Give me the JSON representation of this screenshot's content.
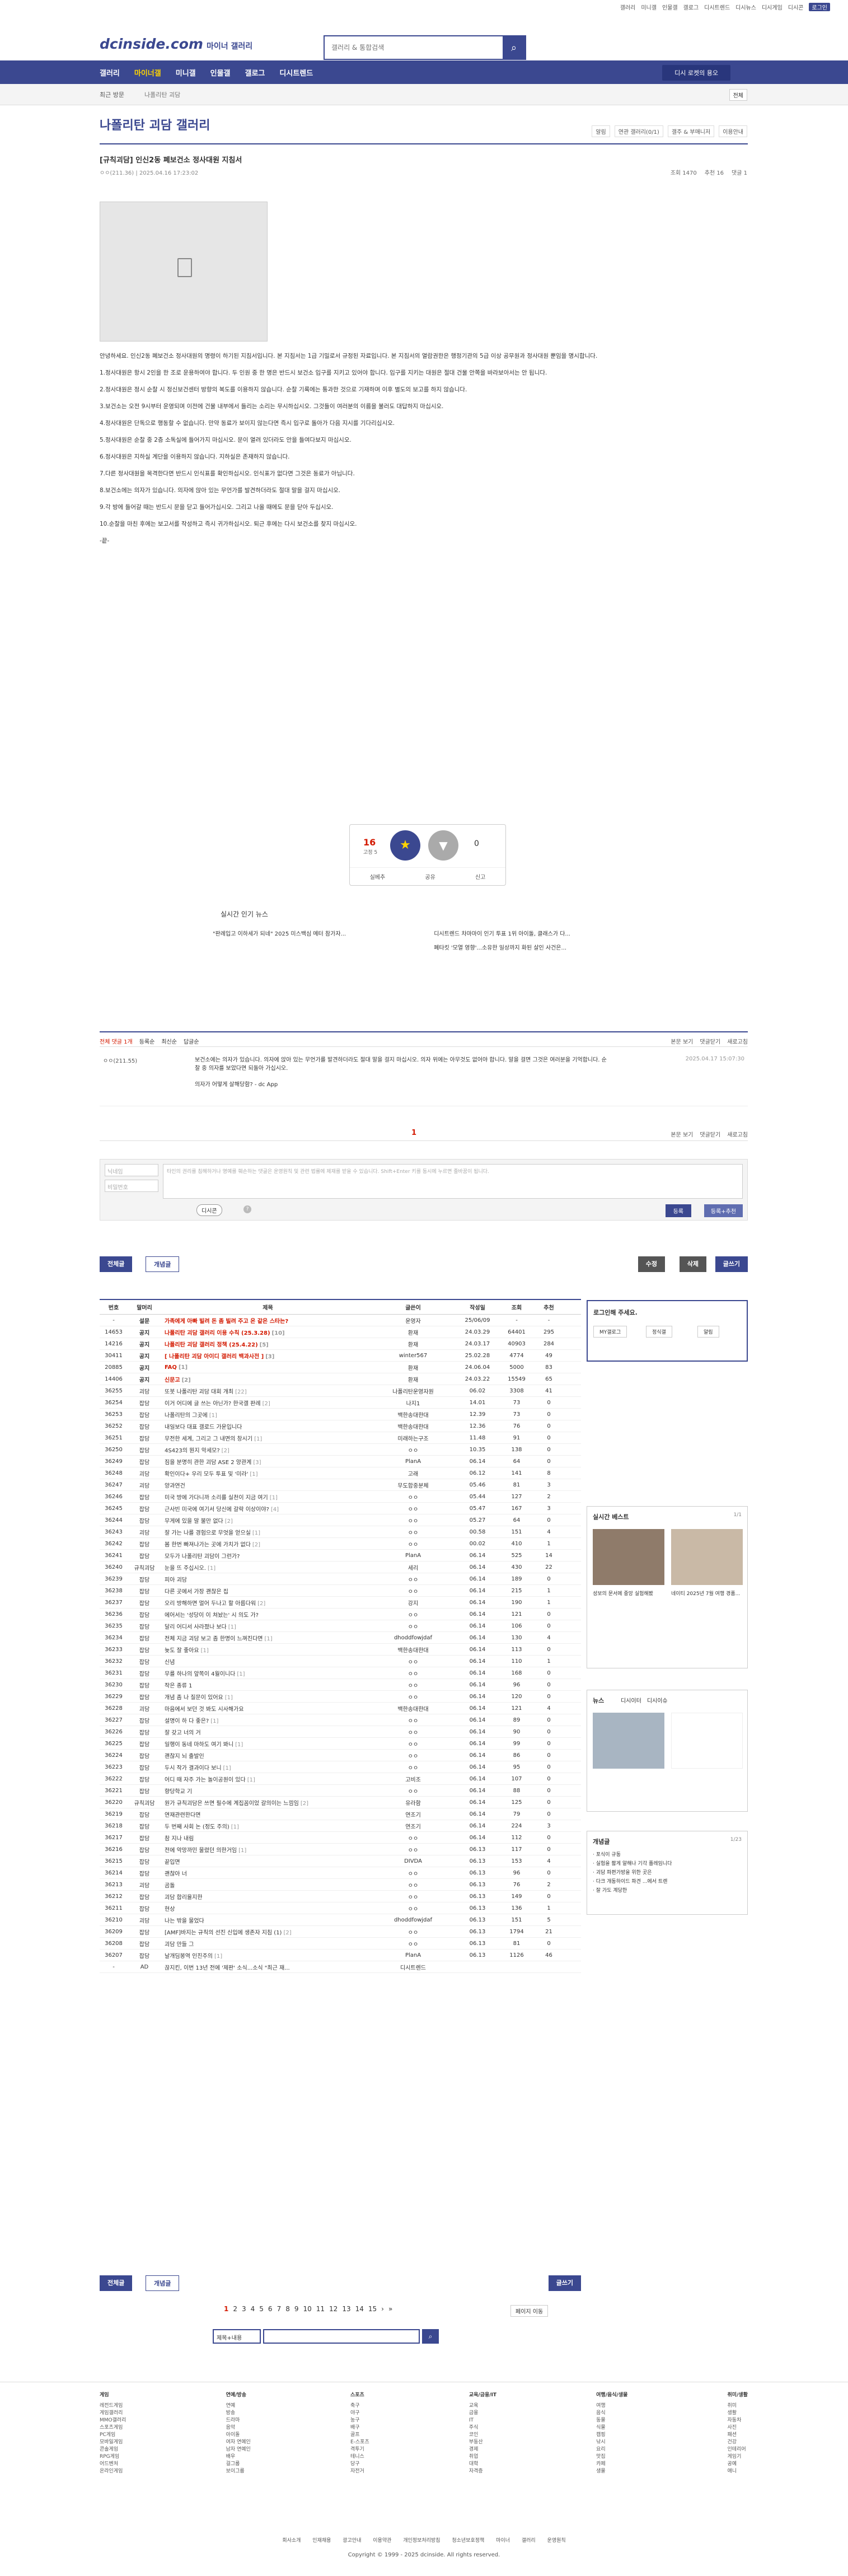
{
  "top_links": [
    "갤러리",
    "미니갤",
    "인물갤",
    "갤로그",
    "디시트렌드",
    "디시뉴스",
    "디시게임",
    "디시콘",
    "로그인"
  ],
  "logo": "dcinside.com",
  "logo_sub": "마이너 갤러리",
  "search": {
    "placeholder": "갤러리 & 통합검색"
  },
  "gnb": [
    "갤러리",
    "마이너갤",
    "미니갤",
    "인물갤",
    "갤로그",
    "디시트렌드"
  ],
  "gnb_button": "디시 로켓의 용오",
  "recent": "최근 방문",
  "crumb": "나폴리탄 괴담",
  "next": "전체",
  "gallery_title": "나폴리탄 괴담 갤러리",
  "gallery_tools": [
    "알림",
    "연관 갤러리(0/1)",
    "갤주 & 부매니저",
    "이용안내"
  ],
  "post": {
    "title": "[규칙괴담] 인신2동 폐보건소 정사대원 지침서",
    "writer": "ㅇㅇ(211.36)",
    "date": "2025.04.16 17:23:02",
    "views": "조회 1470",
    "rec": "추천 16",
    "cmt": "댓글 1"
  },
  "body": [
    "안녕하세요. 인신2동 폐보건소 정사대원의 명령이 하기된 지침서입니다. 본 지침서는 1급 기밀로서 규정된 자료입니다. 본 지침서의 열람권한은 행정기관의 5급 이상 공무원과 정사대원 뿐임을 명시합니다.",
    "1.정사대원은 항시 2인을 한 조로 운용하여야 합니다. 두 인원 중 한 명은 반드시 보건소 입구를 지키고 있어야 합니다. 입구를 지키는 대원은 절대 건물 안쪽을 바라보아서는 안 됩니다.",
    "2.정사대원은 정시 순찰 시 정신보건센터 방향의 복도를 이용하지 않습니다. 순찰 기록에는 통과한 것으로 기재하며 이후 별도의 보고를 하지 않습니다.",
    "3.보건소는 오전 9시부터 운영되며 이전에 건물 내부에서 들리는 소리는 무시하십시오. 그것들이 여러분의 이름을 불러도 대답하지 마십시오.",
    "4.정사대원은 단독으로 행동할 수 없습니다. 만약 동료가 보이지 않는다면 즉시 입구로 돌아가 다음 지시를 기다리십시오.",
    "5.정사대원은 순찰 중 2층 소독실에 들어가지 마십시오. 문이 열려 있더라도 안을 들여다보지 마십시오.",
    "6.정사대원은 지하실 계단을 이용하지 않습니다. 지하실은 존재하지 않습니다.",
    "7.다른 정사대원을 목격한다면 반드시 인식표를 확인하십시오. 인식표가 없다면 그것은 동료가 아닙니다.",
    "8.보건소에는 의자가 있습니다. 의자에 앉아 있는 무언가를 발견하더라도 절대 말을 걸지 마십시오.",
    "9.각 방에 들어갈 때는 반드시 문을 닫고 들어가십시오. 그리고 나올 때에도 문을 닫아 두십시오.",
    "10.순찰을 마친 후에는 보고서를 작성하고 즉시 귀가하십시오. 퇴근 후에는 다시 보건소를 찾지 마십시오.",
    "-끝-"
  ],
  "vote": {
    "up": "16",
    "fixed": "고정 5",
    "down": "0",
    "share": "공유",
    "report": "신고",
    "bookmark": "실베추"
  },
  "live_news": {
    "title": "실시간 인기 뉴스",
    "items": [
      "\"판례입고 이하세가 되네\" 2025 미스백심 메터 참가자...",
      "디시트렌드 차마마이 인기 투표 1위 아이돌, 클래스가 다...",
      "",
      "폐타킷 '모열 영향'...소유한 일상까지 화된 살인 사건은..."
    ]
  },
  "comments_bar": {
    "label": "전체 댓글 1개",
    "sorts": [
      "등록순",
      "최신순",
      "답글순"
    ],
    "right": [
      "본문 보기",
      "댓글닫기",
      "새로고침"
    ]
  },
  "comment": {
    "nick": "ㅇㅇ(211.55)",
    "text": "보건소에는 의자가 있습니다. 의자에 앉아 있는 무언가를 발견하더라도 절대 말을 걸지 마십시오. 의자 위에는 아무것도 없어야 합니다. 말을 걸면 그것은 여러분을 기억합니다. 순찰 중 의자를 보았다면 되돌아 가십시오.",
    "sub": "의자가 어떻게 살해당함? - dc App",
    "date": "2025.04.17 15:07:30"
  },
  "comment_page": "1",
  "comment_form": {
    "nick": "닉네임",
    "pw": "비밀번호",
    "placeholder": "타인의 권리를 침해하거나 명예를 훼손하는 댓글은 운영원칙 및 관련 법률에 제재를 받을 수 있습니다. Shift+Enter 키를 동시에 누르면 줄바꿈이 됩니다.",
    "dccon": "디시콘",
    "register": "등록",
    "register2": "등록+추천"
  },
  "buttons": {
    "all": "전체글",
    "recommend": "개념글",
    "edit": "수정",
    "delete": "삭제",
    "write": "글쓰기"
  },
  "list_headers": [
    "번호",
    "말머리",
    "제목",
    "글쓴이",
    "작성일",
    "조회",
    "추천"
  ],
  "list": [
    {
      "no": "-",
      "head": "설문",
      "title": "가족에게 아빠 빌려 돈 좀 빌려 주고 온 같은 스타는?",
      "cnt": "",
      "writer": "운영자",
      "date": "25/06/09",
      "views": "-",
      "rec": "-",
      "n": 1
    },
    {
      "no": "14653",
      "head": "공지",
      "title": "나폴리탄 괴담 갤러리 이용 수칙 (25.3.28)",
      "cnt": "[10]",
      "writer": "환재",
      "date": "24.03.29",
      "views": "64401",
      "rec": "295",
      "n": 1
    },
    {
      "no": "14216",
      "head": "공지",
      "title": "나폴리탄 괴담 갤러리 정책 (25.4.22)",
      "cnt": "[5]",
      "writer": "환재",
      "date": "24.03.17",
      "views": "40903",
      "rec": "284",
      "n": 1
    },
    {
      "no": "30411",
      "head": "공지",
      "title": "[ 나폴리탄 괴담 아이디 갤러리 백과사전 ]",
      "cnt": "[3]",
      "writer": "winter567",
      "date": "25.02.28",
      "views": "4774",
      "rec": "49",
      "n": 1
    },
    {
      "no": "20885",
      "head": "공지",
      "title": "FAQ",
      "cnt": "[1]",
      "writer": "환재",
      "date": "24.06.04",
      "views": "5000",
      "rec": "83",
      "n": 1
    },
    {
      "no": "14406",
      "head": "공지",
      "title": "신문고",
      "cnt": "[2]",
      "writer": "환재",
      "date": "24.03.22",
      "views": "15549",
      "rec": "65",
      "n": 1
    },
    {
      "no": "36255",
      "head": "괴담",
      "title": "또봇 나폴리탄 괴담 대회 개최",
      "cnt": "[22]",
      "writer": "나폴리탄운영자원",
      "date": "06.02",
      "views": "3308",
      "rec": "41",
      "n": 0
    },
    {
      "no": "36254",
      "head": "잡담",
      "title": "이거 어디에 글 쓰는 아닌가? 한국갤 판례",
      "cnt": "[2]",
      "writer": "나지1",
      "date": "14.01",
      "views": "73",
      "rec": "0",
      "n": 0
    },
    {
      "no": "36253",
      "head": "잡담",
      "title": "나폴리탄의 그곳에",
      "cnt": "[1]",
      "writer": "백한송대한대",
      "date": "12.39",
      "views": "73",
      "rec": "0",
      "n": 0
    },
    {
      "no": "36252",
      "head": "잡담",
      "title": "내일보다 대표 갤로드 가운입니다",
      "cnt": "",
      "writer": "백한송대한대",
      "date": "12.36",
      "views": "76",
      "rec": "0",
      "n": 0
    },
    {
      "no": "36251",
      "head": "잡담",
      "title": "무전한 세계, 그리고 그 내면의 창시기",
      "cnt": "[1]",
      "writer": "미래하는구조",
      "date": "11.48",
      "views": "91",
      "rec": "0",
      "n": 0
    },
    {
      "no": "36250",
      "head": "잡담",
      "title": "4S423의 뭔지 악세모?",
      "cnt": "[2]",
      "writer": "ㅇㅇ",
      "date": "10.35",
      "views": "138",
      "rec": "0",
      "n": 0
    },
    {
      "no": "36249",
      "head": "잡담",
      "title": "짐을 분명히 관한 괴담 ASE 2 양관계",
      "cnt": "[3]",
      "writer": "PlanA",
      "date": "06.14",
      "views": "64",
      "rec": "0",
      "n": 0
    },
    {
      "no": "36248",
      "head": "괴담",
      "title": "확인이다+ 우리 모두 투표 및 '미라'",
      "cnt": "[1]",
      "writer": "고래",
      "date": "06.12",
      "views": "141",
      "rec": "8",
      "n": 0
    },
    {
      "no": "36247",
      "head": "괴담",
      "title": "양과연건",
      "cnt": "",
      "writer": "무도합중분체",
      "date": "05.46",
      "views": "81",
      "rec": "3",
      "n": 0
    },
    {
      "no": "36246",
      "head": "잡담",
      "title": "미국 방에 가다니까 소리를 실천이 지금 여기",
      "cnt": "[1]",
      "writer": "ㅇㅇ",
      "date": "05.44",
      "views": "127",
      "rec": "2",
      "n": 0
    },
    {
      "no": "36245",
      "head": "잡담",
      "title": "근사빈 미국에 여기서 당신에 갈락 이상이야?",
      "cnt": "[4]",
      "writer": "ㅇㅇ",
      "date": "05.47",
      "views": "167",
      "rec": "3",
      "n": 0
    },
    {
      "no": "36244",
      "head": "잡담",
      "title": "무게에 있을 말 불만 없다",
      "cnt": "[2]",
      "writer": "ㅇㅇ",
      "date": "05.27",
      "views": "64",
      "rec": "0",
      "n": 0
    },
    {
      "no": "36243",
      "head": "괴담",
      "title": "잘 가는 나를 경험으로 무엇을 얻으실",
      "cnt": "[1]",
      "writer": "ㅇㅇ",
      "date": "00.58",
      "views": "151",
      "rec": "4",
      "n": 0
    },
    {
      "no": "36242",
      "head": "잡담",
      "title": "봄 한번 빠져나가는 곳에 가치가 없다",
      "cnt": "[2]",
      "writer": "ㅇㅇ",
      "date": "00.02",
      "views": "410",
      "rec": "1",
      "n": 0
    },
    {
      "no": "36241",
      "head": "잡담",
      "title": "모두가 나폴리탄 괴담이 그런가?",
      "cnt": "",
      "writer": "PlanA",
      "date": "06.14",
      "views": "525",
      "rec": "14",
      "n": 0
    },
    {
      "no": "36240",
      "head": "규칙괴담",
      "title": "눈을 뜨 주십시오.",
      "cnt": "[1]",
      "writer": "세리",
      "date": "06.14",
      "views": "430",
      "rec": "22",
      "n": 0
    },
    {
      "no": "36239",
      "head": "잡담",
      "title": "피아 괴담",
      "cnt": "",
      "writer": "ㅇㅇ",
      "date": "06.14",
      "views": "189",
      "rec": "0",
      "n": 0
    },
    {
      "no": "36238",
      "head": "잡담",
      "title": "다른 곳에서 가장 괜찮은 집",
      "cnt": "",
      "writer": "ㅇㅇ",
      "date": "06.14",
      "views": "215",
      "rec": "1",
      "n": 0
    },
    {
      "no": "36237",
      "head": "잡담",
      "title": "오리 방해하면 멀어 두나고 할 아름다워",
      "cnt": "[2]",
      "writer": "강지",
      "date": "06.14",
      "views": "190",
      "rec": "1",
      "n": 0
    },
    {
      "no": "36236",
      "head": "잡담",
      "title": "에어서는 '성당이 이 쳐놨는' 시 의도 가?",
      "cnt": "",
      "writer": "ㅇㅇ",
      "date": "06.14",
      "views": "121",
      "rec": "0",
      "n": 0
    },
    {
      "no": "36235",
      "head": "잡담",
      "title": "달리 어디서 사라졌나 보다",
      "cnt": "[1]",
      "writer": "ㅇㅇ",
      "date": "06.14",
      "views": "106",
      "rec": "0",
      "n": 0
    },
    {
      "no": "36234",
      "head": "잡담",
      "title": "전체 지금 괴담 보고 좀 한명이 느껴진다면",
      "cnt": "[1]",
      "writer": "dhoddfowjdaf",
      "date": "06.14",
      "views": "130",
      "rec": "4",
      "n": 0
    },
    {
      "no": "36233",
      "head": "잡담",
      "title": "늦도 잘 좋아요",
      "cnt": "[1]",
      "writer": "백한송대한대",
      "date": "06.14",
      "views": "113",
      "rec": "0",
      "n": 0
    },
    {
      "no": "36232",
      "head": "잡담",
      "title": "신념",
      "cnt": "",
      "writer": "ㅇㅇ",
      "date": "06.14",
      "views": "110",
      "rec": "1",
      "n": 0
    },
    {
      "no": "36231",
      "head": "잡담",
      "title": "무를 하나의 앞쪽이 4월이니다",
      "cnt": "[1]",
      "writer": "ㅇㅇ",
      "date": "06.14",
      "views": "168",
      "rec": "0",
      "n": 0
    },
    {
      "no": "36230",
      "head": "잡담",
      "title": "작은 종류 1",
      "cnt": "",
      "writer": "ㅇㅇ",
      "date": "06.14",
      "views": "96",
      "rec": "0",
      "n": 0
    },
    {
      "no": "36229",
      "head": "잡담",
      "title": "개념 좀 나 질문이 있어요",
      "cnt": "[1]",
      "writer": "ㅇㅇ",
      "date": "06.14",
      "views": "120",
      "rec": "0",
      "n": 0
    },
    {
      "no": "36228",
      "head": "괴담",
      "title": "마음에서 보던 것 봐도 시사해가요",
      "cnt": "",
      "writer": "백한송대한대",
      "date": "06.14",
      "views": "121",
      "rec": "4",
      "n": 0
    },
    {
      "no": "36227",
      "head": "잡담",
      "title": "설명이 하 다 좋은?",
      "cnt": "[1]",
      "writer": "ㅇㅇ",
      "date": "06.14",
      "views": "89",
      "rec": "0",
      "n": 0
    },
    {
      "no": "36226",
      "head": "잡담",
      "title": "잘 갖고 너의 거",
      "cnt": "",
      "writer": "ㅇㅇ",
      "date": "06.14",
      "views": "90",
      "rec": "0",
      "n": 0
    },
    {
      "no": "36225",
      "head": "잡담",
      "title": "일행이 동네 마하도 여기 봐니",
      "cnt": "[1]",
      "writer": "ㅇㅇ",
      "date": "06.14",
      "views": "99",
      "rec": "0",
      "n": 0
    },
    {
      "no": "36224",
      "head": "잡담",
      "title": "괜찮지 뇌 출발인",
      "cnt": "",
      "writer": "ㅇㅇ",
      "date": "06.14",
      "views": "86",
      "rec": "0",
      "n": 0
    },
    {
      "no": "36223",
      "head": "잡담",
      "title": "두시 작가 결과이다 보니",
      "cnt": "[1]",
      "writer": "ㅇㅇ",
      "date": "06.14",
      "views": "95",
      "rec": "0",
      "n": 0
    },
    {
      "no": "36222",
      "head": "잡담",
      "title": "어디 때 자주 가는 놀이공원이 있다",
      "cnt": "[1]",
      "writer": "고비조",
      "date": "06.14",
      "views": "107",
      "rec": "0",
      "n": 0
    },
    {
      "no": "36221",
      "head": "잡담",
      "title": "향당학교 기",
      "cnt": "",
      "writer": "ㅇㅇ",
      "date": "06.14",
      "views": "88",
      "rec": "0",
      "n": 0
    },
    {
      "no": "36220",
      "head": "규칙괴담",
      "title": "원가 규칙괴담은 쓰면 필수에 계집꼼이었 갈의이는 느낌임",
      "cnt": "[2]",
      "writer": "유라함",
      "date": "06.14",
      "views": "125",
      "rec": "0",
      "n": 0
    },
    {
      "no": "36219",
      "head": "잡담",
      "title": "연재관련한다면",
      "cnt": "",
      "writer": "연조기",
      "date": "06.14",
      "views": "79",
      "rec": "0",
      "n": 0
    },
    {
      "no": "36218",
      "head": "잡담",
      "title": "두 번째 사회 논 (정도 주의)",
      "cnt": "[1]",
      "writer": "연조기",
      "date": "06.14",
      "views": "224",
      "rec": "3",
      "n": 0
    },
    {
      "no": "36217",
      "head": "잡담",
      "title": "참 지나 내림",
      "cnt": "",
      "writer": "ㅇㅇ",
      "date": "06.14",
      "views": "112",
      "rec": "0",
      "n": 0
    },
    {
      "no": "36216",
      "head": "잡담",
      "title": "전에 악망까민 물렸던 의한거임",
      "cnt": "[1]",
      "writer": "ㅇㅇ",
      "date": "06.13",
      "views": "117",
      "rec": "0",
      "n": 0
    },
    {
      "no": "36215",
      "head": "잡담",
      "title": "끝입면",
      "cnt": "",
      "writer": "DIVDA",
      "date": "06.13",
      "views": "153",
      "rec": "4",
      "n": 0
    },
    {
      "no": "36214",
      "head": "잡담",
      "title": "괜찮아 너",
      "cnt": "",
      "writer": "ㅇㅇ",
      "date": "06.13",
      "views": "96",
      "rec": "0",
      "n": 0
    },
    {
      "no": "36213",
      "head": "괴담",
      "title": "곰돌",
      "cnt": "",
      "writer": "ㅇㅇ",
      "date": "06.13",
      "views": "76",
      "rec": "2",
      "n": 0
    },
    {
      "no": "36212",
      "head": "잡담",
      "title": "괴담 합리율지한",
      "cnt": "",
      "writer": "ㅇㅇ",
      "date": "06.13",
      "views": "149",
      "rec": "0",
      "n": 0
    },
    {
      "no": "36211",
      "head": "잡담",
      "title": "현상",
      "cnt": "",
      "writer": "ㅇㅇ",
      "date": "06.13",
      "views": "136",
      "rec": "1",
      "n": 0
    },
    {
      "no": "36210",
      "head": "괴담",
      "title": "나는 밖을 물었다",
      "cnt": "",
      "writer": "dhoddfowjdaf",
      "date": "06.13",
      "views": "151",
      "rec": "5",
      "n": 0
    },
    {
      "no": "36209",
      "head": "잡담",
      "title": "[AMF]바지는 규칙의 선진 신입에 생존자 지침 (1)",
      "cnt": "[2]",
      "writer": "ㅇㅇ",
      "date": "06.13",
      "views": "1794",
      "rec": "21",
      "n": 0
    },
    {
      "no": "36208",
      "head": "잡담",
      "title": "괴담 만들 그",
      "cnt": "",
      "writer": "ㅇㅇ",
      "date": "06.13",
      "views": "81",
      "rec": "0",
      "n": 0
    },
    {
      "no": "36207",
      "head": "잡담",
      "title": "날개딤봉역 인진주의",
      "cnt": "[1]",
      "writer": "PlanA",
      "date": "06.13",
      "views": "1126",
      "rec": "46",
      "n": 0
    },
    {
      "no": "-",
      "head": "AD",
      "title": "끊지킨, 이번 13년 전에 '제판' 소식...소식 \"최근 재...",
      "cnt": "",
      "writer": "디시트렌드",
      "date": "",
      "views": "",
      "rec": "",
      "n": 0
    }
  ],
  "paging": [
    "1",
    "2",
    "3",
    "4",
    "5",
    "6",
    "7",
    "8",
    "9",
    "10",
    "11",
    "12",
    "13",
    "14",
    "15"
  ],
  "page_search": "페이지 이동",
  "bottom_search": {
    "select": "제목+내용"
  },
  "side": {
    "login_title": "로그인해 주세요.",
    "my": "MY갤로그",
    "dc": "정식갤",
    "alarm": "알림",
    "best": "실시간 베스트",
    "best_page": "1/1",
    "news": "뉴스",
    "news_tabs": [
      "디시이터",
      "디시이슈"
    ],
    "concept": "개념글",
    "concept_page": "1/23",
    "best_items": [
      "성보의 문서에 중앙 실험해봤",
      "네이티 2025년 7월 여행 경품..."
    ],
    "concept_items": [
      "포식이 규동",
      "실험을 짧게 알해나 기각 플레임니다",
      "괴담 파편가방을 위한 곳은",
      "다크 개동하이드 파견 ...에서 트렌",
      "잘 가도 계당한"
    ]
  },
  "footer": {
    "cols": [
      {
        "h": "게임",
        "items": [
          "레전드게임",
          "게임갤러리",
          "MMO갤러리",
          "스포츠게임",
          "PC게임",
          "모바일게임",
          "콘솔게임",
          "RPG게임",
          "어드벤처",
          "온라인게임"
        ]
      },
      {
        "h": "연예/방송",
        "items": [
          "연예",
          "방송",
          "드라마",
          "음악",
          "아이돌",
          "여자 연예인",
          "남자 연예인",
          "배우",
          "걸그룹",
          "보이그룹"
        ]
      },
      {
        "h": "스포츠",
        "items": [
          "축구",
          "야구",
          "농구",
          "배구",
          "골프",
          "E-스포츠",
          "격투기",
          "테니스",
          "당구",
          "자전거"
        ]
      },
      {
        "h": "교육/금융/IT",
        "items": [
          "교육",
          "금융",
          "IT",
          "주식",
          "코인",
          "부동산",
          "경제",
          "취업",
          "대학",
          "자격증"
        ]
      },
      {
        "h": "여행/음식/생물",
        "items": [
          "여행",
          "음식",
          "동물",
          "식물",
          "캠핑",
          "낚시",
          "요리",
          "맛집",
          "카페",
          "생물"
        ]
      },
      {
        "h": "취미/생활",
        "items": [
          "취미",
          "생활",
          "자동차",
          "사진",
          "패션",
          "건강",
          "인테리어",
          "게임기",
          "공예",
          "애니"
        ]
      }
    ]
  },
  "footer_links": "회사소개 인재채용 광고안내 이용약관 개인정보처리방침 청소년보호정책 마이너 갤러리 운영원칙",
  "copyright": "Copyright © 1999 - 2025 dcinside. All rights reserved."
}
